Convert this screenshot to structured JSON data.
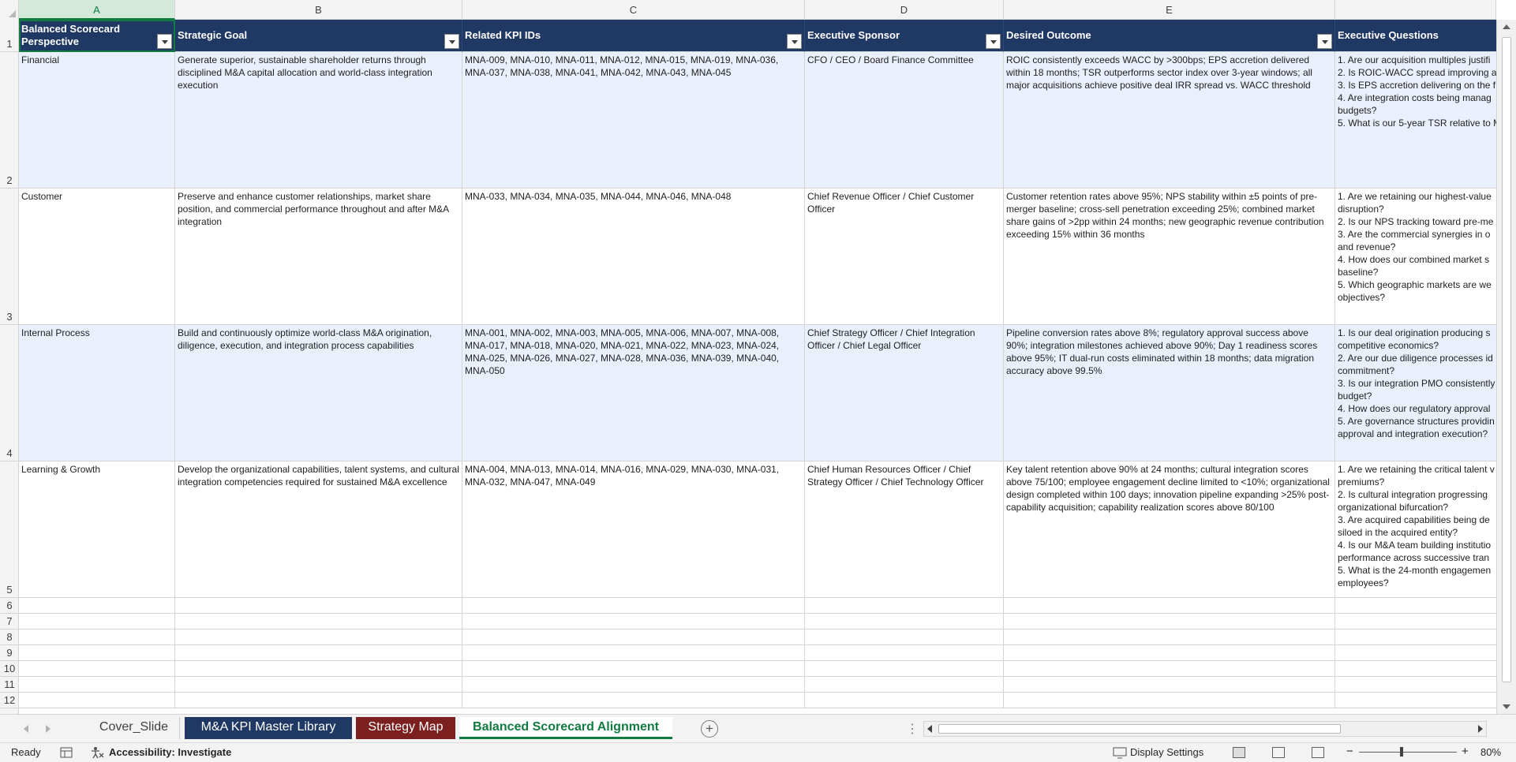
{
  "columns": [
    "A",
    "B",
    "C",
    "D",
    "E",
    ""
  ],
  "rows": [
    "1",
    "2",
    "3",
    "4",
    "5",
    "6",
    "7",
    "8",
    "9",
    "10",
    "11",
    "12"
  ],
  "headers": [
    "Balanced Scorecard Perspective",
    "Strategic Goal",
    "Related KPI IDs",
    "Executive Sponsor",
    "Desired Outcome",
    "Executive Questions"
  ],
  "records": [
    {
      "perspective": "Financial",
      "goal": "Generate superior, sustainable shareholder returns through disciplined M&A capital allocation and world-class integration execution",
      "kpis": "MNA-009, MNA-010, MNA-011, MNA-012, MNA-015, MNA-019, MNA-036, MNA-037, MNA-038, MNA-041, MNA-042, MNA-043, MNA-045",
      "sponsor": "CFO / CEO / Board Finance Committee",
      "outcome": "ROIC consistently exceeds WACC by >300bps; EPS accretion delivered within 18 months; TSR outperforms sector index over 3-year windows; all major acquisitions achieve positive deal IRR spread vs. WACC threshold",
      "questions": [
        "1. Are our acquisition multiples justifi",
        "2. Is ROIC-WACC spread improving a",
        "3. Is EPS accretion delivering on the f",
        "4. Are integration costs being manag",
        "budgets?",
        "5. What is our 5-year TSR relative to M"
      ]
    },
    {
      "perspective": "Customer",
      "goal": "Preserve and enhance customer relationships, market share position, and commercial performance throughout and after M&A integration",
      "kpis": "MNA-033, MNA-034, MNA-035, MNA-044, MNA-046, MNA-048",
      "sponsor": "Chief Revenue Officer / Chief Customer Officer",
      "outcome": "Customer retention rates above 95%; NPS stability within ±5 points of pre-merger baseline; cross-sell penetration exceeding 25%; combined market share gains of >2pp within 24 months; new geographic revenue contribution exceeding 15% within 36 months",
      "questions": [
        "1. Are we retaining our highest-value",
        "disruption?",
        "2. Is our NPS tracking toward pre-me",
        "3. Are the commercial synergies in o",
        "and revenue?",
        "4. How does our combined market s",
        "baseline?",
        "5. Which geographic markets are we",
        "objectives?"
      ]
    },
    {
      "perspective": "Internal Process",
      "goal": "Build and continuously optimize world-class M&A origination, diligence, execution, and integration process capabilities",
      "kpis": "MNA-001, MNA-002, MNA-003, MNA-005, MNA-006, MNA-007, MNA-008, MNA-017, MNA-018, MNA-020, MNA-021, MNA-022, MNA-023, MNA-024, MNA-025, MNA-026, MNA-027, MNA-028, MNA-036, MNA-039, MNA-040, MNA-050",
      "sponsor": "Chief Strategy Officer / Chief Integration Officer / Chief Legal Officer",
      "outcome": "Pipeline conversion rates above 8%; regulatory approval success above 90%; integration milestones achieved above 90%; Day 1 readiness scores above 95%; IT dual-run costs eliminated within 18 months; data migration accuracy above 99.5%",
      "questions": [
        "1. Is our deal origination producing s",
        "competitive economics?",
        "2. Are our due diligence processes id",
        "commitment?",
        "3. Is our integration PMO consistently",
        "budget?",
        "4. How does our regulatory approval",
        "5. Are governance structures providin",
        "approval and integration execution?"
      ]
    },
    {
      "perspective": "Learning & Growth",
      "goal": "Develop the organizational capabilities, talent systems, and cultural integration competencies required for sustained M&A excellence",
      "kpis": "MNA-004, MNA-013, MNA-014, MNA-016, MNA-029, MNA-030, MNA-031, MNA-032, MNA-047, MNA-049",
      "sponsor": "Chief Human Resources Officer / Chief Strategy Officer / Chief Technology Officer",
      "outcome": "Key talent retention above 90% at 24 months; cultural integration scores above 75/100; employee engagement decline limited to <10%; organizational design completed within 100 days; innovation pipeline expanding >25% post-capability acquisition; capability realization scores above 80/100",
      "questions": [
        "1. Are we retaining the critical talent v",
        "premiums?",
        "2. Is cultural integration progressing",
        "organizational bifurcation?",
        "3. Are acquired capabilities being de",
        "siloed in the acquired entity?",
        "4. Is our M&A team building institutio",
        "performance across successive tran",
        "5. What is the 24-month engagemen",
        "employees?"
      ]
    }
  ],
  "tabs": [
    {
      "label": "Cover_Slide",
      "style": "plain"
    },
    {
      "label": "M&A KPI Master Library",
      "style": "blue",
      "color": "#1f3864"
    },
    {
      "label": "Strategy Map",
      "style": "red",
      "color": "#7b1f1f"
    },
    {
      "label": "Balanced Scorecard Alignment",
      "style": "active"
    }
  ],
  "status": {
    "ready": "Ready",
    "accessibility": "Accessibility: Investigate",
    "display_settings": "Display Settings",
    "zoom": "80%",
    "zoom_level": 0.42
  },
  "icons": {
    "add_sheet": "+",
    "zoom_minus": "−",
    "zoom_plus": "+",
    "more": "⋮"
  },
  "colors": {
    "header_fill": "#1f3864",
    "band_fill": "#e9effb",
    "accent": "#107c41"
  }
}
